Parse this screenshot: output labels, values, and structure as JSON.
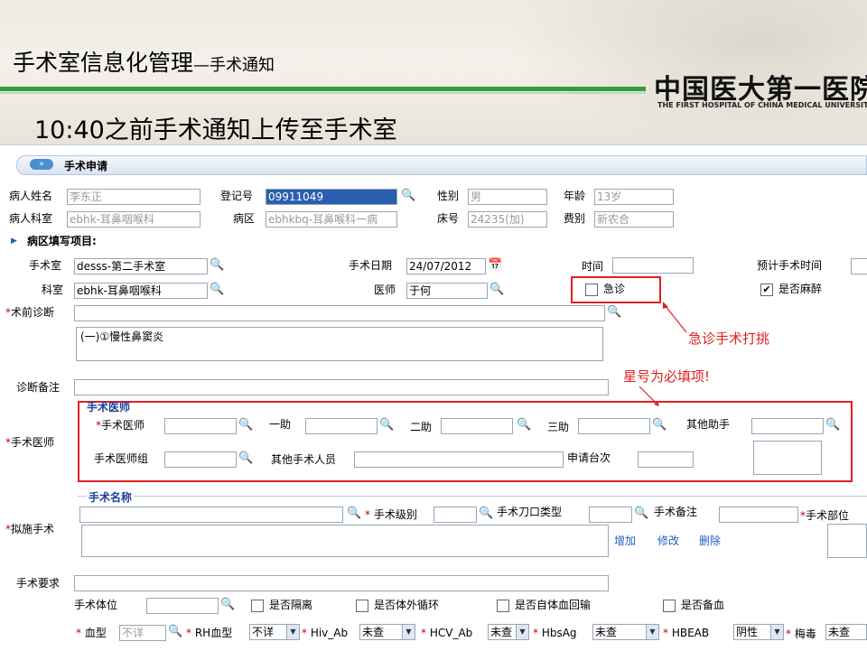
{
  "slide": {
    "title_main": "手术室信息化管理",
    "title_sub": "—手术通知",
    "headline": "10:40之前手术通知上传至手术室",
    "logo_cn": "中国医大第一医院",
    "logo_en": "THE FIRST HOSPITAL OF CHINA MEDICAL UNIVERSITY"
  },
  "panel": {
    "header": "手术申请",
    "arrow_glyph": "»"
  },
  "patient": {
    "name_label": "病人姓名",
    "name_value": "李东正",
    "reg_label": "登记号",
    "reg_value": "09911049",
    "sex_label": "性别",
    "sex_value": "男",
    "age_label": "年龄",
    "age_value": "13岁",
    "dept_label": "病人科室",
    "dept_value": "ebhk-耳鼻咽喉科",
    "ward_label": "病区",
    "ward_value": "ebhkbq-耳鼻喉科一病",
    "bed_label": "床号",
    "bed_value": "24235(加)",
    "fee_label": "费别",
    "fee_value": "新农合"
  },
  "ward_section": "病区填写项目:",
  "op": {
    "room_label": "手术室",
    "room_value": "desss-第二手术室",
    "date_label": "手术日期",
    "date_value": "24/07/2012",
    "time_label": "时间",
    "time_value": "",
    "est_label": "预计手术时间",
    "dept_label": "科室",
    "dept_value": "ebhk-耳鼻咽喉科",
    "doctor_label": "医师",
    "doctor_value": "于何",
    "emergency_label": "急诊",
    "emergency_checked": false,
    "anesthesia_label": "是否麻醉",
    "anesthesia_checked": true,
    "pre_diag_label": "术前诊断",
    "pre_diag_text": "(一)①慢性鼻窦炎",
    "diag_note_label": "诊断备注"
  },
  "annotations": {
    "emergency_note": "急诊手术打挑",
    "required_note": "星号为必填项!"
  },
  "surgeon": {
    "row_label": "手术医师",
    "group_title": "手术医师",
    "surgeon_label": "手术医师",
    "assist1_label": "一助",
    "assist2_label": "二助",
    "assist3_label": "三助",
    "other_assist_label": "其他助手",
    "team_label": "手术医师组",
    "other_staff_label": "其他手术人员",
    "tables_label": "申请台次"
  },
  "planned": {
    "row_label": "拟施手术",
    "group_title": "手术名称",
    "level_label": "手术级别",
    "incision_label": "手术刀口类型",
    "note_label": "手术备注",
    "site_label": "手术部位",
    "add_link": "增加",
    "edit_link": "修改",
    "delete_link": "删除"
  },
  "requirements": {
    "req_label": "手术要求",
    "position_label": "手术体位",
    "isolation_label": "是否隔离",
    "ecc_label": "是否体外循环",
    "autologous_label": "是否自体血回输",
    "blood_prep_label": "是否备血"
  },
  "labs": {
    "blood_type_label": "血型",
    "blood_type_value": "不详",
    "rh_label": "RH血型",
    "rh_value": "不详",
    "hiv_label": "Hiv_Ab",
    "hiv_value": "未查",
    "hcv_label": "HCV_Ab",
    "hcv_value": "未查",
    "hbsag_label": "HbsAg",
    "hbsag_value": "未查",
    "hbeab_label": "HBEAB",
    "hbeab_value": "阴性",
    "syphilis_label": "梅毒",
    "syphilis_value": "未查"
  },
  "required_mark": "*",
  "colors": {
    "accent_green": "#2f9e3e",
    "annotation_red": "#e02020",
    "group_title_blue": "#1f3f9f"
  }
}
